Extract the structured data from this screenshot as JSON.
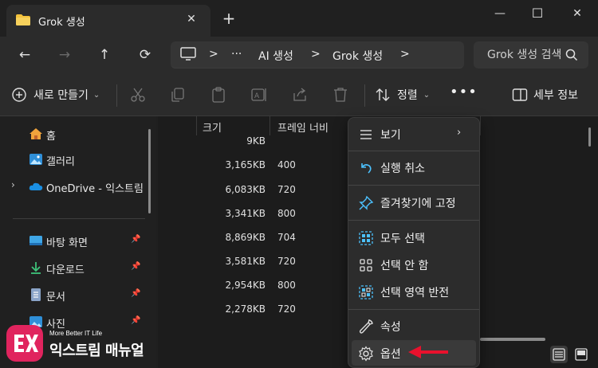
{
  "window": {
    "tab_title": "Grok 생성",
    "tab_close": "✕",
    "new_tab": "+",
    "minimize": "—",
    "maximize": "☐",
    "close": "✕"
  },
  "address_bar": {
    "back": "←",
    "forward": "→",
    "up": "↑",
    "refresh": "⟳",
    "path_sep": ">",
    "path_more": "···",
    "path": [
      "AI 생성",
      "Grok 생성"
    ],
    "search_placeholder": "Grok 생성 검색"
  },
  "toolbar": {
    "new_label": "새로 만들기",
    "dropdown_chevron": "⌄",
    "sort_label": "정렬",
    "more": "•••",
    "details_label": "세부 정보"
  },
  "sidebar": {
    "items": [
      {
        "label": "홈",
        "icon": "home-icon"
      },
      {
        "label": "갤러리",
        "icon": "gallery-icon"
      },
      {
        "label": "OneDrive - 익스트림",
        "icon": "onedrive-icon",
        "expander": "›"
      },
      {
        "label": "바탕 화면",
        "icon": "desktop-folder-icon",
        "pinned": true
      },
      {
        "label": "다운로드",
        "icon": "download-icon",
        "pinned": true
      },
      {
        "label": "문서",
        "icon": "documents-icon",
        "pinned": true
      },
      {
        "label": "사진",
        "icon": "pictures-icon",
        "pinned": true
      }
    ],
    "pin_glyph": "📌"
  },
  "file_list": {
    "columns": [
      "크기",
      "프레임 너비"
    ],
    "rows": [
      {
        "size": "9KB",
        "width": ""
      },
      {
        "size": "3,165KB",
        "width": "400"
      },
      {
        "size": "6,083KB",
        "width": "720"
      },
      {
        "size": "3,341KB",
        "width": "800"
      },
      {
        "size": "8,869KB",
        "width": "704"
      },
      {
        "size": "3,581KB",
        "width": "720"
      },
      {
        "size": "2,954KB",
        "width": "800"
      },
      {
        "size": "2,278KB",
        "width": "720"
      }
    ]
  },
  "context_menu": {
    "view": "보기",
    "view_arrow": "›",
    "undo": "실행 취소",
    "pin_quick": "즐겨찾기에 고정",
    "select_all": "모두 선택",
    "select_none": "선택 안 함",
    "invert": "선택 영역 반전",
    "properties": "속성",
    "options": "옵션"
  },
  "watermark": {
    "tagline": "More Better IT Life",
    "brand": "익스트림 매뉴얼"
  },
  "colors": {
    "accent_blue": "#4cc2ff",
    "arrow_red": "#e8112d",
    "folder_yellow": "#f3c23c"
  }
}
